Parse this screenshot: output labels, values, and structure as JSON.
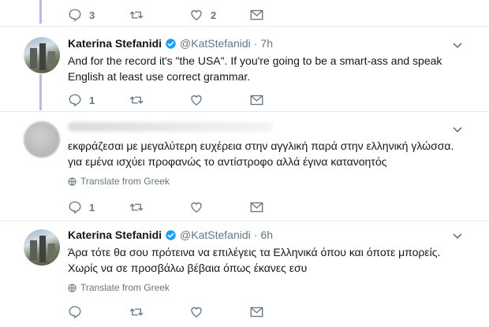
{
  "top_actions": {
    "reply_count": "3",
    "like_count": "2"
  },
  "tweets": [
    {
      "name": "Katerina Stefanidi",
      "handle": "@KatStefanidi",
      "sep": "·",
      "time": "7h",
      "lines": [
        "And for the record it's \"the USA\". If you're going to be a smart-ass and speak",
        "English at least use correct grammar."
      ],
      "reply_count": "1"
    },
    {
      "lines": [
        "εκφράζεσαι με μεγαλύτερη ευχέρεια στην αγγλική παρά στην ελληνική γλώσσα.",
        "για εμένα ισχύει προφανώς το αντίστροφο αλλά έγινα κατανοητός"
      ],
      "translate": "Translate from Greek",
      "reply_count": "1"
    },
    {
      "name": "Katerina Stefanidi",
      "handle": "@KatStefanidi",
      "sep": "·",
      "time": "6h",
      "lines": [
        "Άρα τότε θα σου πρότεινα να επιλέγεις τα Ελληνικά όπου και όποτε μπορείς.",
        "Χωρίς να σε προσβάλω βέβαια όπως έκανες εσυ"
      ],
      "translate": "Translate from Greek"
    }
  ],
  "colors": {
    "thread_line": "#c4b5e8",
    "verified": "#1da1f2",
    "muted": "#657786"
  }
}
